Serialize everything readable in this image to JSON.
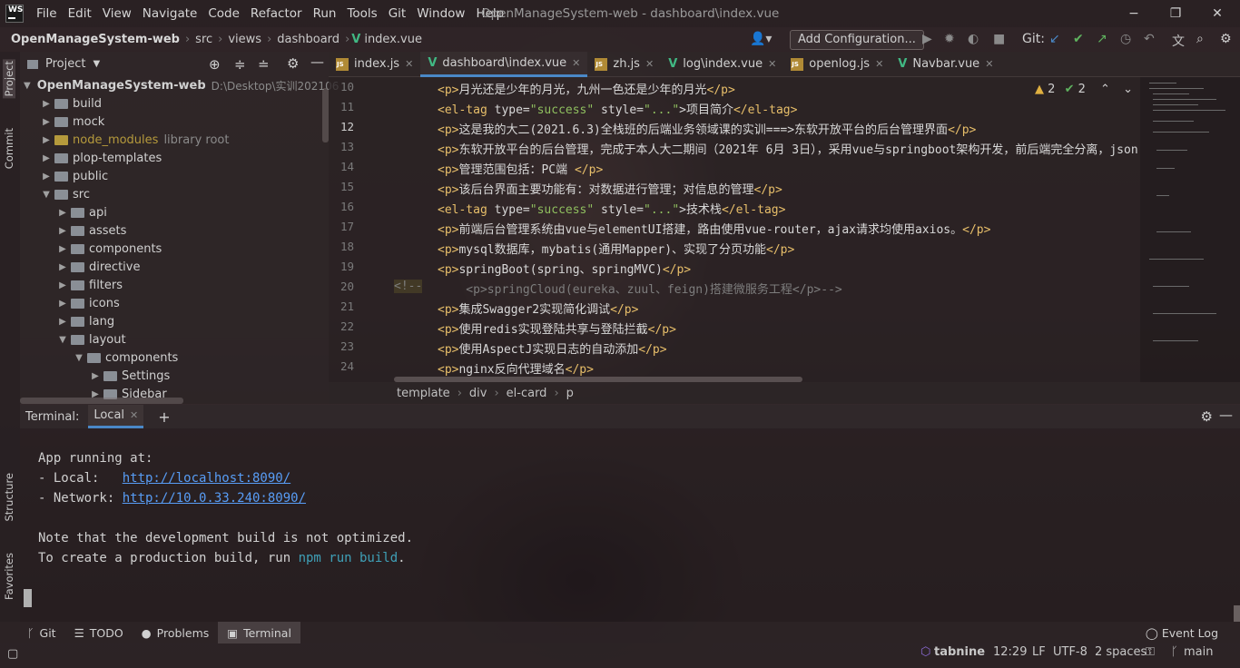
{
  "titlebar": {
    "logo": "WS",
    "menu": [
      "File",
      "Edit",
      "View",
      "Navigate",
      "Code",
      "Refactor",
      "Run",
      "Tools",
      "Git",
      "Window",
      "Help"
    ],
    "title": "OpenManageSystem-web - dashboard\\index.vue",
    "minimize": "−",
    "maximize": "❐",
    "close": "✕"
  },
  "navbar": {
    "breadcrumb": [
      "OpenManageSystem-web",
      "src",
      "views",
      "dashboard",
      "index.vue"
    ],
    "add_configuration": "Add Configuration...",
    "git_label": "Git:"
  },
  "left_strip": {
    "project": "Project",
    "commit": "Commit",
    "structure": "Structure",
    "favorites": "Favorites"
  },
  "project_panel": {
    "title": "Project",
    "root_name": "OpenManageSystem-web",
    "root_path": "D:\\Desktop\\实训202106",
    "items": [
      {
        "label": "build",
        "muted": ""
      },
      {
        "label": "mock",
        "muted": ""
      },
      {
        "label": "node_modules",
        "muted": "library root"
      },
      {
        "label": "plop-templates",
        "muted": ""
      },
      {
        "label": "public",
        "muted": ""
      },
      {
        "label": "src",
        "muted": ""
      },
      {
        "label": "api",
        "muted": ""
      },
      {
        "label": "assets",
        "muted": ""
      },
      {
        "label": "components",
        "muted": ""
      },
      {
        "label": "directive",
        "muted": ""
      },
      {
        "label": "filters",
        "muted": ""
      },
      {
        "label": "icons",
        "muted": ""
      },
      {
        "label": "lang",
        "muted": ""
      },
      {
        "label": "layout",
        "muted": ""
      },
      {
        "label": "components",
        "muted": ""
      },
      {
        "label": "Settings",
        "muted": ""
      },
      {
        "label": "Sidebar",
        "muted": ""
      }
    ]
  },
  "editor_tabs": [
    {
      "label": "index.js",
      "type": "js"
    },
    {
      "label": "dashboard\\index.vue",
      "type": "vue"
    },
    {
      "label": "zh.js",
      "type": "js"
    },
    {
      "label": "log\\index.vue",
      "type": "vue"
    },
    {
      "label": "openlog.js",
      "type": "js"
    },
    {
      "label": "Navbar.vue",
      "type": "vue"
    }
  ],
  "editor": {
    "inspections": {
      "warnings": "2",
      "weak": "2"
    },
    "lines": [
      {
        "n": "10",
        "t1": "<p>",
        "t2": "月光还是少年的月光，九州一色还是少年的月光",
        "t3": "</p>"
      },
      {
        "n": "11",
        "t1": "<el-tag ",
        "a": "type=",
        "s": "\"success\"",
        "a2": " style=",
        "s2": "\"...\"",
        "t2": ">项目简介",
        "t3": "</el-tag>"
      },
      {
        "n": "12",
        "t1": "<p>",
        "t2": "这是我的大二(2021.6.3)全栈班的后端业务领域课的实训===>东软开放平台的后台管理界面",
        "t3": "</p>"
      },
      {
        "n": "13",
        "t1": "<p>",
        "t2": "东软开放平台的后台管理，完成于本人大二期间（2021年 6月 3日），采用vue与springboot架构开发，前后端完全分离，json",
        "t3": ""
      },
      {
        "n": "14",
        "t1": "<p>",
        "t2": "管理范围包括：PC端 ",
        "t3": "</p>"
      },
      {
        "n": "15",
        "t1": "<p>",
        "t2": "该后台界面主要功能有：对数据进行管理；对信息的管理",
        "t3": "</p>"
      },
      {
        "n": "16",
        "t1": "<el-tag ",
        "a": "type=",
        "s": "\"success\"",
        "a2": " style=",
        "s2": "\"...\"",
        "t2": ">技术栈",
        "t3": "</el-tag>"
      },
      {
        "n": "17",
        "t1": "<p>",
        "t2": "前端后台管理系统由vue与elementUI搭建，路由使用vue-router，ajax请求均使用axios。",
        "t3": "</p>"
      },
      {
        "n": "18",
        "t1": "<p>",
        "t2": "mysql数据库，mybatis(通用Mapper)、实现了分页功能",
        "t3": "</p>"
      },
      {
        "n": "19",
        "t1": "<p>",
        "t2": "springBoot(spring、springMVC)",
        "t3": "</p>"
      },
      {
        "n": "20",
        "comment_mark": "<!--",
        "comment": "    <p>springCloud(eureka、zuul、feign)搭建微服务工程</p>-->"
      },
      {
        "n": "21",
        "t1": "<p>",
        "t2": "集成Swagger2实现简化调试",
        "t3": "</p>"
      },
      {
        "n": "22",
        "t1": "<p>",
        "t2": "使用redis实现登陆共享与登陆拦截",
        "t3": "</p>"
      },
      {
        "n": "23",
        "t1": "<p>",
        "t2": "使用AspectJ实现日志的自动添加",
        "t3": "</p>"
      },
      {
        "n": "24",
        "t1": "<p>",
        "t2": "nginx反向代理域名",
        "t3": "</p>"
      }
    ]
  },
  "editor_breadcrumb": [
    "template",
    "div",
    "el-card",
    "p"
  ],
  "terminal": {
    "label": "Terminal:",
    "tab": "Local",
    "add": "+",
    "line1": "App running at:",
    "line2_prefix": "- Local:   ",
    "local_url": "http://localhost:8090/",
    "line3_prefix": "- Network: ",
    "network_url": "http://10.0.33.240:8090/",
    "line4": "Note that the development build is not optimized.",
    "line5_prefix": "To create a production build, run ",
    "line5_cmd": "npm run build",
    "line5_suffix": "."
  },
  "bottom_tools": {
    "git": "Git",
    "todo": "TODO",
    "problems": "Problems",
    "terminal": "Terminal",
    "event_log": "Event Log"
  },
  "statusbar": {
    "tabnine": "tabnine",
    "position": "12:29",
    "line_sep": "LF",
    "encoding": "UTF-8",
    "indent": "2 spaces",
    "branch": "main"
  }
}
